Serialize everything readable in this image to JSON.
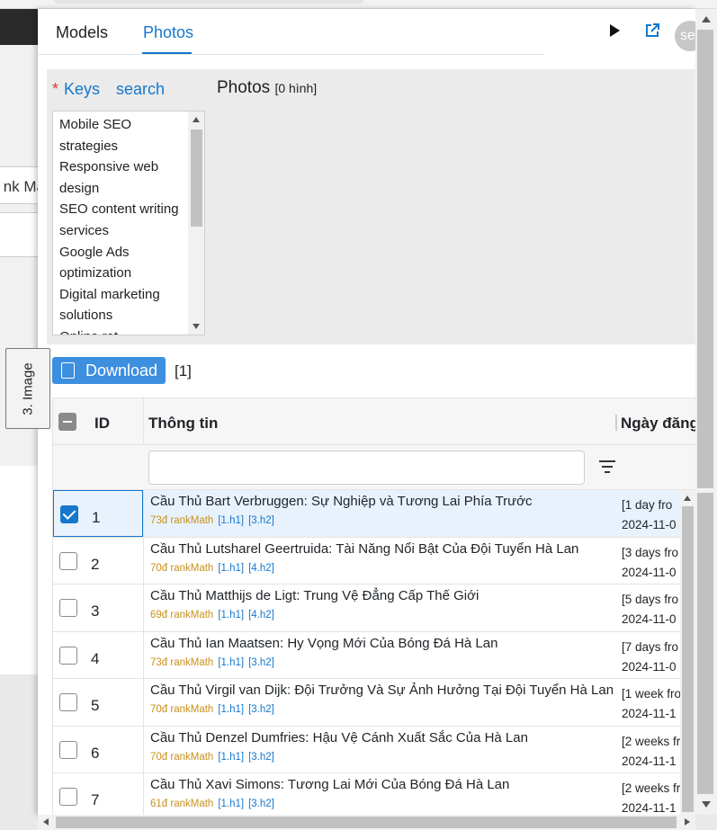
{
  "background": {
    "partial_text": "nk Ma"
  },
  "side_tab": {
    "label": "3. Image"
  },
  "tabs": [
    {
      "label": "Models"
    },
    {
      "label": "Photos",
      "active": true
    }
  ],
  "header": {
    "avatar_text": "se"
  },
  "filters": {
    "keys_label": "Keys",
    "required_mark": "*",
    "search_link": "search",
    "photos_title": "Photos",
    "photos_count": "[0 hình]",
    "keyword_options": [
      "Mobile SEO strategies",
      "Responsive web design",
      "SEO content writing services",
      "Google Ads optimization",
      "Digital marketing solutions",
      "Online ret"
    ]
  },
  "download": {
    "label": "Download",
    "count": "[1]"
  },
  "table": {
    "columns": {
      "id": "ID",
      "info": "Thông tin",
      "date": "Ngày đăng"
    },
    "filter_value": "",
    "rows": [
      {
        "id": "1",
        "checked": true,
        "title": "Cầu Thủ Bart Verbruggen: Sự Nghiệp và Tương Lai Phía Trước",
        "score": "73đ rankMath",
        "h1": "[1.h1]",
        "h2": "[3.h2]",
        "date_rel": "[1 day fro",
        "date": "2024-11-0"
      },
      {
        "id": "2",
        "checked": false,
        "title": "Cầu Thủ Lutsharel Geertruida: Tài Năng Nổi Bật Của Đội Tuyển Hà Lan",
        "score": "70đ rankMath",
        "h1": "[1.h1]",
        "h2": "[4.h2]",
        "date_rel": "[3 days fro",
        "date": "2024-11-0"
      },
      {
        "id": "3",
        "checked": false,
        "title": "Cầu Thủ Matthijs de Ligt: Trung Vệ Đẳng Cấp Thế Giới",
        "score": "69đ rankMath",
        "h1": "[1.h1]",
        "h2": "[4.h2]",
        "date_rel": "[5 days fro",
        "date": "2024-11-0"
      },
      {
        "id": "4",
        "checked": false,
        "title": "Cầu Thủ Ian Maatsen: Hy Vọng Mới Của Bóng Đá Hà Lan",
        "score": "73đ rankMath",
        "h1": "[1.h1]",
        "h2": "[3.h2]",
        "date_rel": "[7 days fro",
        "date": "2024-11-0"
      },
      {
        "id": "5",
        "checked": false,
        "title": "Cầu Thủ Virgil van Dijk: Đội Trưởng Và Sự Ảnh Hưởng Tại Đội Tuyển Hà Lan",
        "score": "70đ rankMath",
        "h1": "[1.h1]",
        "h2": "[3.h2]",
        "date_rel": "[1 week fro",
        "date": "2024-11-1"
      },
      {
        "id": "6",
        "checked": false,
        "title": "Cầu Thủ Denzel Dumfries: Hậu Vệ Cánh Xuất Sắc Của Hà Lan",
        "score": "70đ rankMath",
        "h1": "[1.h1]",
        "h2": "[3.h2]",
        "date_rel": "[2 weeks fr",
        "date": "2024-11-1"
      },
      {
        "id": "7",
        "checked": false,
        "title": "Cầu Thủ Xavi Simons: Tương Lai Mới Của Bóng Đá Hà Lan",
        "score": "61đ rankMath",
        "h1": "[1.h1]",
        "h2": "[3.h2]",
        "date_rel": "[2 weeks fr",
        "date": "2024-11-1"
      }
    ]
  }
}
